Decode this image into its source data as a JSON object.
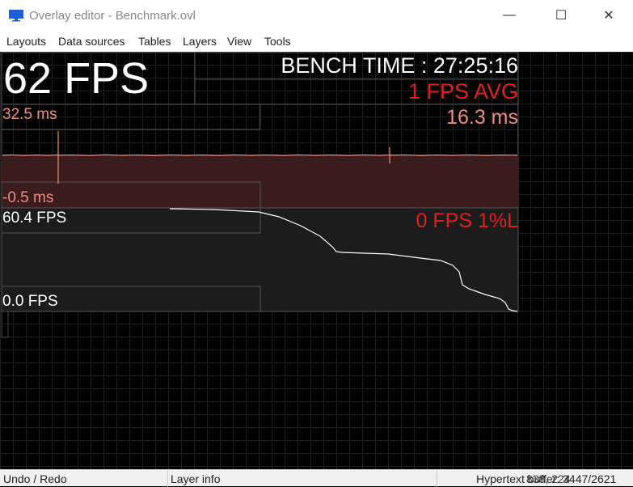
{
  "window": {
    "title": "Overlay editor - Benchmark.ovl",
    "minimize_glyph": "—",
    "maximize_glyph": "☐",
    "close_glyph": "✕"
  },
  "menu": [
    "Layouts",
    "Data sources",
    "Tables",
    "Layers",
    "View",
    "Tools"
  ],
  "overlay": {
    "fps": "62 FPS",
    "bench_time": "BENCH TIME : 27:25:16",
    "fps_avg": "1 FPS AVG",
    "frametime_max": "32.5 ms",
    "frametime_current": "16.3 ms",
    "frametime_min": "-0.5 ms",
    "fps_graph_max": "60.4 FPS",
    "fps_1pct_low": "0 FPS 1%L",
    "fps_graph_min": "0.0 FPS"
  },
  "status": {
    "undo_redo": "Undo / Redo",
    "layer_info": "Layer info",
    "hypertext": "Hypertext buffer: 3447/2621",
    "coords": "838, 224"
  },
  "colors": {
    "text_white": "#ffffff",
    "accent_red": "#e0201c",
    "frametime_pink": "#f08a84",
    "graph_fill_red": "#3a1c1c"
  },
  "icons": {
    "app": "monitor-icon"
  }
}
